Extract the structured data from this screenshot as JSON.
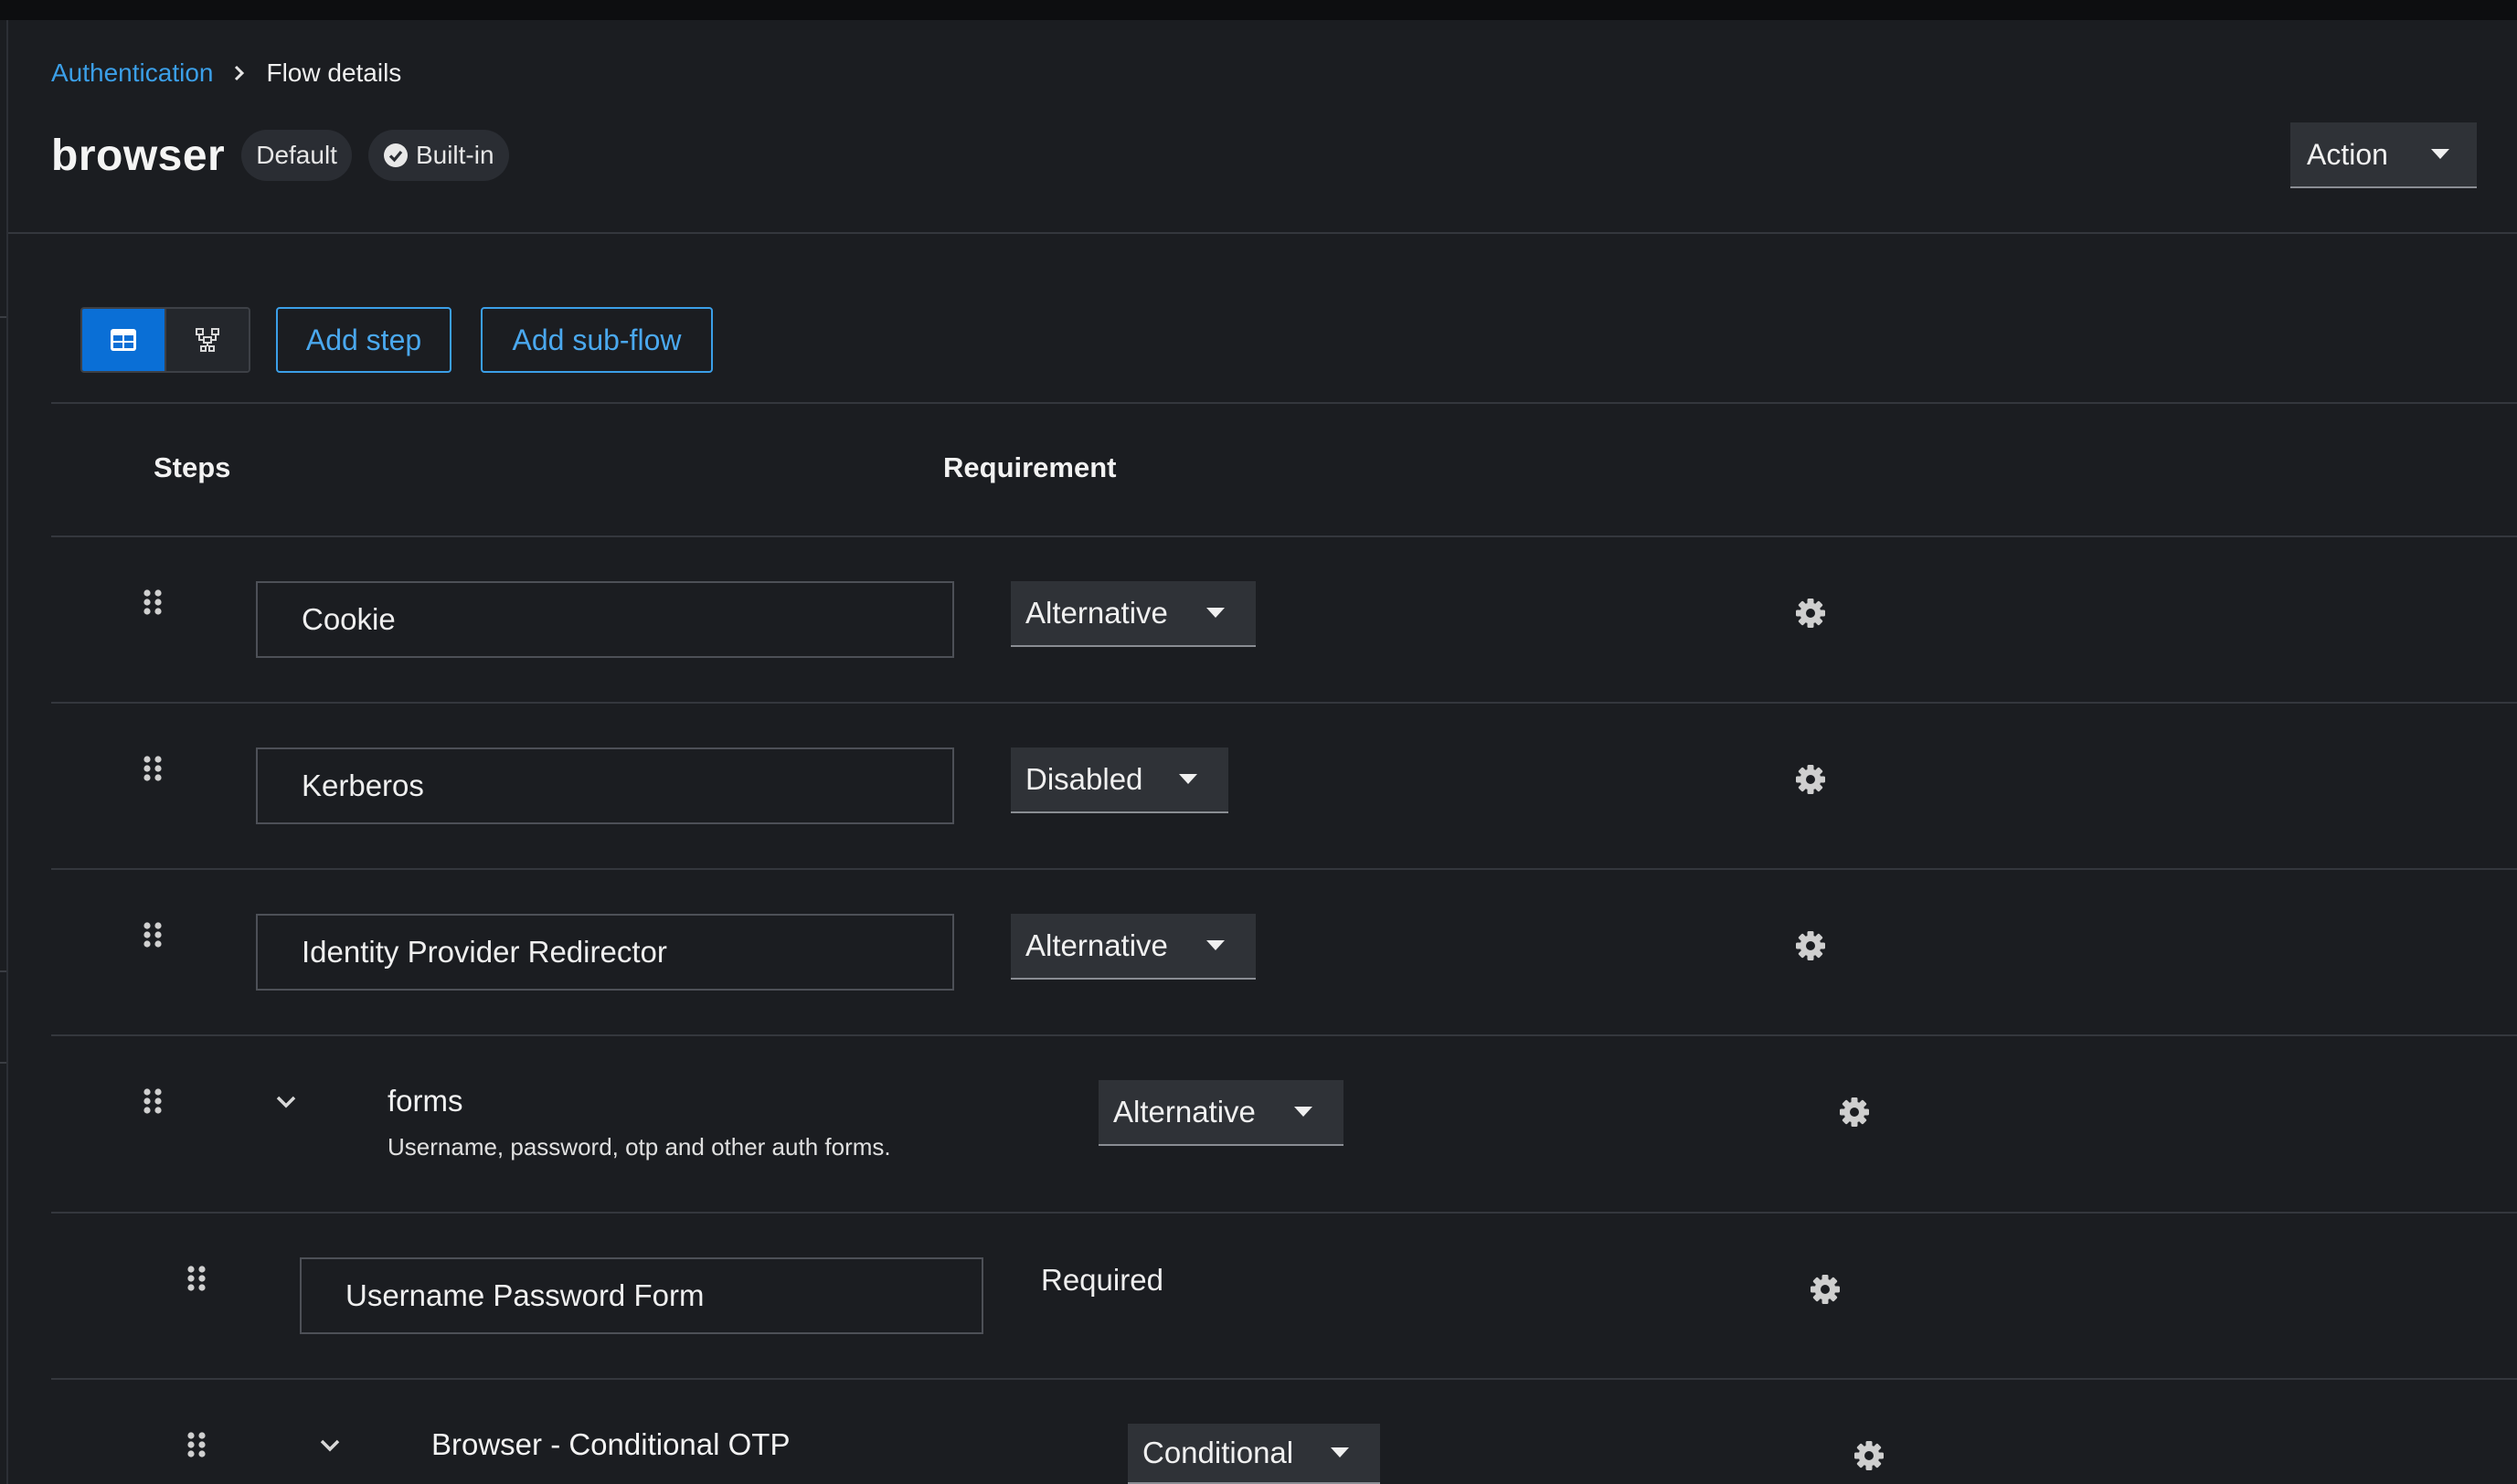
{
  "breadcrumb": {
    "parent": "Authentication",
    "current": "Flow details"
  },
  "header": {
    "title": "browser",
    "badges": [
      "Default",
      "Built-in"
    ],
    "action_label": "Action"
  },
  "toolbar": {
    "add_step_label": "Add step",
    "add_subflow_label": "Add sub-flow"
  },
  "table": {
    "columns": [
      "Steps",
      "Requirement"
    ],
    "rows": [
      {
        "name": "Cookie",
        "requirement": "Alternative"
      },
      {
        "name": "Kerberos",
        "requirement": "Disabled"
      },
      {
        "name": "Identity Provider Redirector",
        "requirement": "Alternative"
      },
      {
        "name": "forms",
        "description": "Username, password, otp and other auth forms.",
        "requirement": "Alternative"
      },
      {
        "name": "Username Password Form",
        "requirement": "Required"
      },
      {
        "name": "Browser - Conditional OTP",
        "requirement": "Conditional"
      }
    ]
  },
  "colors": {
    "background": "#1b1d21",
    "accent": "#3b9fe8",
    "active_toggle": "#0a6fd6"
  },
  "icons": [
    "chevron-right-icon",
    "check-circle-icon",
    "caret-down-icon",
    "table-view-icon",
    "diagram-view-icon",
    "drag-handle-icon",
    "gear-icon",
    "chevron-down-icon"
  ]
}
